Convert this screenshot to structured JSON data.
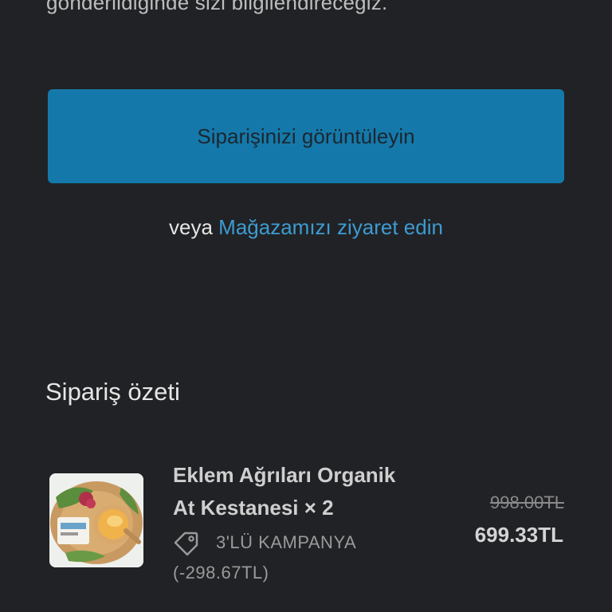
{
  "notice": {
    "text": "gönderildiğinde sizi bilgilendireceğiz."
  },
  "actions": {
    "view_order_label": "Siparişinizi görüntüleyin",
    "or_word": "veya",
    "visit_store_label": "Mağazamızı ziyaret edin"
  },
  "summary": {
    "title": "Sipariş özeti",
    "items": [
      {
        "name_line1": "Eklem Ağrıları Organik",
        "name_line2": "At Kestanesi × 2",
        "discount_label": "3'LÜ KAMPANYA",
        "discount_amount": "(-298.67TL)",
        "original_price": "998.00TL",
        "price": "699.33TL"
      }
    ]
  },
  "colors": {
    "background": "#212225",
    "button": "#1479aa",
    "link": "#3d9bd1"
  },
  "icons": {
    "discount": "tag-icon"
  }
}
